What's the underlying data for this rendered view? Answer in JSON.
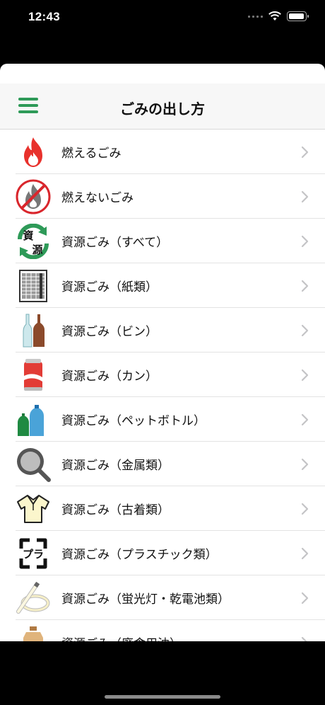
{
  "status": {
    "time": "12:43"
  },
  "nav": {
    "title": "ごみの出し方"
  },
  "items": [
    {
      "label": "燃えるごみ",
      "icon": "fire-icon"
    },
    {
      "label": "燃えないごみ",
      "icon": "no-fire-icon"
    },
    {
      "label": "資源ごみ（すべて）",
      "icon": "recycle-resources-icon",
      "icon_text_top": "資",
      "icon_text_bottom": "源"
    },
    {
      "label": "資源ごみ（紙類）",
      "icon": "paper-bundle-icon"
    },
    {
      "label": "資源ごみ（ビン）",
      "icon": "bottles-icon"
    },
    {
      "label": "資源ごみ（カン）",
      "icon": "can-icon"
    },
    {
      "label": "資源ごみ（ペットボトル）",
      "icon": "pet-bottles-icon"
    },
    {
      "label": "資源ごみ（金属類）",
      "icon": "frying-pan-icon"
    },
    {
      "label": "資源ごみ（古着類）",
      "icon": "shirt-icon"
    },
    {
      "label": "資源ごみ（プラスチック類）",
      "icon": "plastic-mark-icon",
      "icon_text": "プラ"
    },
    {
      "label": "資源ごみ（蛍光灯・乾電池類）",
      "icon": "fluorescent-lamp-icon"
    },
    {
      "label": "資源ごみ（廃食用油）",
      "icon": "oil-container-icon"
    }
  ],
  "colors": {
    "accent": "#2e9a58",
    "fire": "#e8312c",
    "prohibit": "#d9262c"
  }
}
